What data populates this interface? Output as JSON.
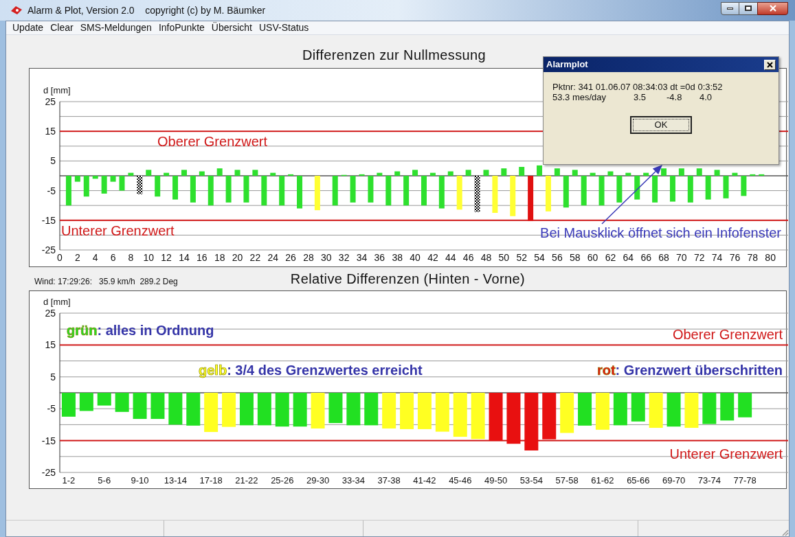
{
  "window": {
    "title": "Alarm & Plot, Version 2.0    copyright (c) by M. Bäumker"
  },
  "menu": [
    {
      "label": "Update"
    },
    {
      "label": "Clear"
    },
    {
      "label": "SMS-Meldungen"
    },
    {
      "label": "InfoPunkte"
    },
    {
      "label": "Übersicht"
    },
    {
      "label": "USV-Status"
    }
  ],
  "top_chart": {
    "title": "Differenzen zur Nullmessung",
    "chart_data": {
      "type": "bar",
      "ylabel": "d [mm]",
      "xlim": [
        0,
        82
      ],
      "ylim": [
        -25,
        25
      ],
      "grid": true,
      "yticks": [
        25,
        15,
        5,
        -5,
        -15,
        -25
      ],
      "xticks": [
        0,
        2,
        4,
        6,
        8,
        10,
        12,
        14,
        16,
        18,
        20,
        22,
        24,
        26,
        28,
        30,
        32,
        34,
        36,
        38,
        40,
        42,
        44,
        46,
        48,
        50,
        52,
        54,
        56,
        58,
        60,
        62,
        64,
        66,
        68,
        70,
        72,
        74,
        76,
        78,
        80
      ],
      "x": [
        1,
        2,
        3,
        4,
        5,
        6,
        7,
        8,
        9,
        10,
        11,
        12,
        13,
        14,
        15,
        16,
        17,
        18,
        19,
        20,
        21,
        22,
        23,
        24,
        25,
        26,
        27,
        29,
        31,
        32,
        33,
        34,
        35,
        36,
        37,
        38,
        39,
        40,
        41,
        42,
        43,
        44,
        45,
        46,
        47,
        48,
        49,
        50,
        51,
        52,
        53,
        54,
        55,
        56,
        57,
        58,
        59,
        60,
        61,
        62,
        63,
        64,
        65,
        66,
        67,
        68,
        69,
        70,
        71,
        72,
        73,
        74,
        75,
        76,
        77,
        78,
        79
      ],
      "series": [
        {
          "color": "#2ee02e",
          "values": [
            -10,
            -2,
            -7,
            -1,
            -6,
            -2,
            -5,
            1,
            null,
            2,
            -7,
            1,
            -8,
            2,
            -9,
            1.5,
            -10,
            2.5,
            -9,
            2,
            -9,
            2,
            -10,
            1,
            -10,
            0.5,
            -11,
            null,
            -10,
            0.3,
            -9,
            0.5,
            -9,
            1,
            -10,
            1.5,
            -10,
            2,
            -10,
            1,
            -11,
            1.5,
            null,
            2,
            null,
            2,
            null,
            2.5,
            null,
            3,
            null,
            3.5,
            null,
            2.5,
            -10.7,
            2,
            -10,
            1,
            -10,
            1.5,
            -9,
            1,
            -8,
            1,
            -9,
            2.5,
            -8.7,
            2.5,
            -9,
            2.5,
            -8,
            2,
            -7.6,
            1,
            -6.8,
            0.5,
            0.5
          ]
        },
        {
          "color": "#ffff33",
          "values": [
            null,
            null,
            null,
            null,
            null,
            null,
            null,
            null,
            null,
            null,
            null,
            null,
            null,
            null,
            null,
            null,
            null,
            null,
            null,
            null,
            null,
            null,
            null,
            null,
            null,
            null,
            null,
            -11.6,
            null,
            null,
            null,
            null,
            null,
            null,
            null,
            null,
            null,
            null,
            null,
            null,
            null,
            null,
            -11.4,
            null,
            null,
            null,
            -12.5,
            null,
            -13.6,
            null,
            null,
            null,
            -12,
            null,
            null,
            null,
            null,
            null,
            null,
            null,
            null,
            null,
            null,
            null,
            null,
            null,
            null,
            null,
            null,
            null,
            null,
            null,
            null,
            null,
            null,
            null,
            null
          ]
        },
        {
          "color": "#e01010",
          "values": [
            null,
            null,
            null,
            null,
            null,
            null,
            null,
            null,
            null,
            null,
            null,
            null,
            null,
            null,
            null,
            null,
            null,
            null,
            null,
            null,
            null,
            null,
            null,
            null,
            null,
            null,
            null,
            null,
            null,
            null,
            null,
            null,
            null,
            null,
            null,
            null,
            null,
            null,
            null,
            null,
            null,
            null,
            null,
            null,
            null,
            null,
            null,
            null,
            null,
            null,
            -15.2,
            null,
            null,
            null,
            null,
            null,
            null,
            null,
            null,
            null,
            null,
            null,
            null,
            null,
            null,
            null,
            null,
            null,
            null,
            null,
            null,
            null,
            null,
            null,
            null,
            null,
            null
          ]
        },
        {
          "color": "#000000",
          "values": [
            null,
            null,
            null,
            null,
            null,
            null,
            null,
            null,
            -6.2,
            null,
            null,
            null,
            null,
            null,
            null,
            null,
            null,
            null,
            null,
            null,
            null,
            null,
            null,
            null,
            null,
            null,
            null,
            null,
            null,
            null,
            null,
            null,
            null,
            null,
            null,
            null,
            null,
            null,
            null,
            null,
            null,
            null,
            null,
            null,
            -12.2,
            null,
            null,
            null,
            null,
            null,
            null,
            null,
            null,
            null,
            null,
            null,
            null,
            null,
            null,
            null,
            null,
            null,
            null,
            null,
            null,
            null,
            null,
            null,
            null,
            null,
            null,
            null,
            null,
            null,
            null,
            null,
            null
          ]
        }
      ],
      "ref_lines": [
        {
          "axis": "y",
          "value": 15,
          "label": "Oberer Grenzwert"
        },
        {
          "axis": "y",
          "value": -15,
          "label": "Unterer Grenzwert"
        }
      ],
      "annotations": [
        "Bei Mausklick öffnet sich ein Infofenster"
      ]
    }
  },
  "wind_reading": "Wind: 17:29:26:   35.9 km/h  289.2 Deg",
  "bottom_chart": {
    "title": "Relative Differenzen (Hinten - Vorne)",
    "chart_data": {
      "type": "bar",
      "ylabel": "d [mm]",
      "ylim": [
        -25,
        25
      ],
      "grid": true,
      "yticks": [
        25,
        15,
        5,
        -5,
        -15,
        -25
      ],
      "categories": [
        "1-2",
        null,
        "5-6",
        null,
        "9-10",
        null,
        "13-14",
        null,
        "17-18",
        null,
        "21-22",
        null,
        "25-26",
        null,
        "29-30",
        null,
        "33-34",
        null,
        "37-38",
        null,
        "41-42",
        null,
        "45-46",
        null,
        "49-50",
        null,
        "53-54",
        null,
        "57-58",
        null,
        "61-62",
        null,
        "65-66",
        null,
        "69-70",
        null,
        "73-74",
        null,
        "77-78"
      ],
      "series": [
        {
          "name": "grün",
          "color": "#22e022",
          "values": [
            -7.5,
            -5.7,
            -4,
            -6,
            -8.2,
            -8.2,
            -10,
            -10.3,
            null,
            null,
            -10.2,
            -10.2,
            -10.6,
            -10.6,
            null,
            -9.5,
            -10.2,
            -10.2,
            null,
            null,
            null,
            null,
            null,
            null,
            null,
            null,
            null,
            null,
            null,
            -10.3,
            null,
            -10.2,
            -9,
            null,
            -10.6,
            null,
            -9.8,
            -8.7,
            -7.7
          ]
        },
        {
          "name": "gelb",
          "color": "#ffff22",
          "values": [
            null,
            null,
            null,
            null,
            null,
            null,
            null,
            null,
            -12.3,
            -10.7,
            null,
            null,
            null,
            null,
            -11.2,
            null,
            null,
            null,
            -11.2,
            -11.4,
            -11.4,
            -12.2,
            -13.8,
            -14.5,
            null,
            null,
            null,
            null,
            -12.6,
            null,
            -11.6,
            null,
            null,
            -11,
            null,
            -11,
            null,
            null,
            null
          ]
        },
        {
          "name": "rot",
          "color": "#e81010",
          "values": [
            null,
            null,
            null,
            null,
            null,
            null,
            null,
            null,
            null,
            null,
            null,
            null,
            null,
            null,
            null,
            null,
            null,
            null,
            null,
            null,
            null,
            null,
            null,
            null,
            -15,
            -16,
            -18.1,
            -14.6,
            null,
            null,
            null,
            null,
            null,
            null,
            null,
            null,
            null,
            null,
            null
          ]
        }
      ],
      "ref_lines": [
        {
          "axis": "y",
          "value": 15,
          "label": "Oberer Grenzwert"
        },
        {
          "axis": "y",
          "value": -15,
          "label": "Unterer Grenzwert"
        }
      ]
    },
    "legend": [
      {
        "text": ": alles in Ordnung"
      },
      {
        "text": ": 3/4 des Grenzwertes erreicht"
      },
      {
        "text": ": Grenzwert überschritten"
      }
    ]
  },
  "dialog": {
    "title": "Alarmplot",
    "line_1": "Pktnr: 341 01.06.07 08:34:03 dt =0d 0:3:52",
    "line_2": [
      "53.3 mes/day",
      "3.5",
      "-4.8",
      "4.0"
    ],
    "ok_button": "OK"
  }
}
